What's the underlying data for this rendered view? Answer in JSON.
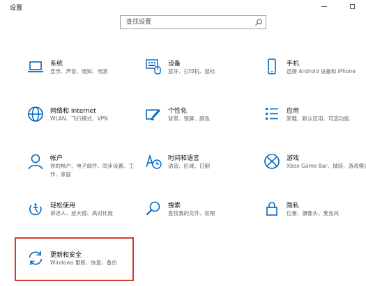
{
  "window": {
    "title": "设置"
  },
  "search": {
    "placeholder": "查找设置"
  },
  "accent_color": "#0067c0",
  "highlight_color": "#d23a2e",
  "tiles": [
    {
      "name": "系统",
      "desc": "显示、声音、通知、电源",
      "icon": "laptop-icon"
    },
    {
      "name": "设备",
      "desc": "蓝牙、打印机、鼠标",
      "icon": "keyboard-devices-icon"
    },
    {
      "name": "手机",
      "desc": "连接 Android 设备和 iPhone",
      "icon": "phone-icon"
    },
    {
      "name": "网络和 Internet",
      "desc": "WLAN、飞行模式、VPN",
      "icon": "globe-icon"
    },
    {
      "name": "个性化",
      "desc": "背景、锁屏、颜色",
      "icon": "paintbrush-icon"
    },
    {
      "name": "应用",
      "desc": "卸载、默认应用、可选功能",
      "icon": "apps-list-icon"
    },
    {
      "name": "帐户",
      "desc": "你的帐户、电子邮件、同步设置、工作、家庭",
      "icon": "person-icon"
    },
    {
      "name": "时间和语言",
      "desc": "语音、区域、日期",
      "icon": "time-language-icon"
    },
    {
      "name": "游戏",
      "desc": "Xbox Game Bar、捕获、游戏模式",
      "icon": "xbox-icon"
    },
    {
      "name": "轻松使用",
      "desc": "讲述人、放大镜、高对比度",
      "icon": "ease-of-access-icon"
    },
    {
      "name": "搜索",
      "desc": "查找我的文件、权限",
      "icon": "search-icon"
    },
    {
      "name": "隐私",
      "desc": "位置、摄像头、麦克风",
      "icon": "lock-icon"
    },
    {
      "name": "更新和安全",
      "desc": "Windows 更新、恢复、备份",
      "icon": "sync-icon"
    }
  ]
}
